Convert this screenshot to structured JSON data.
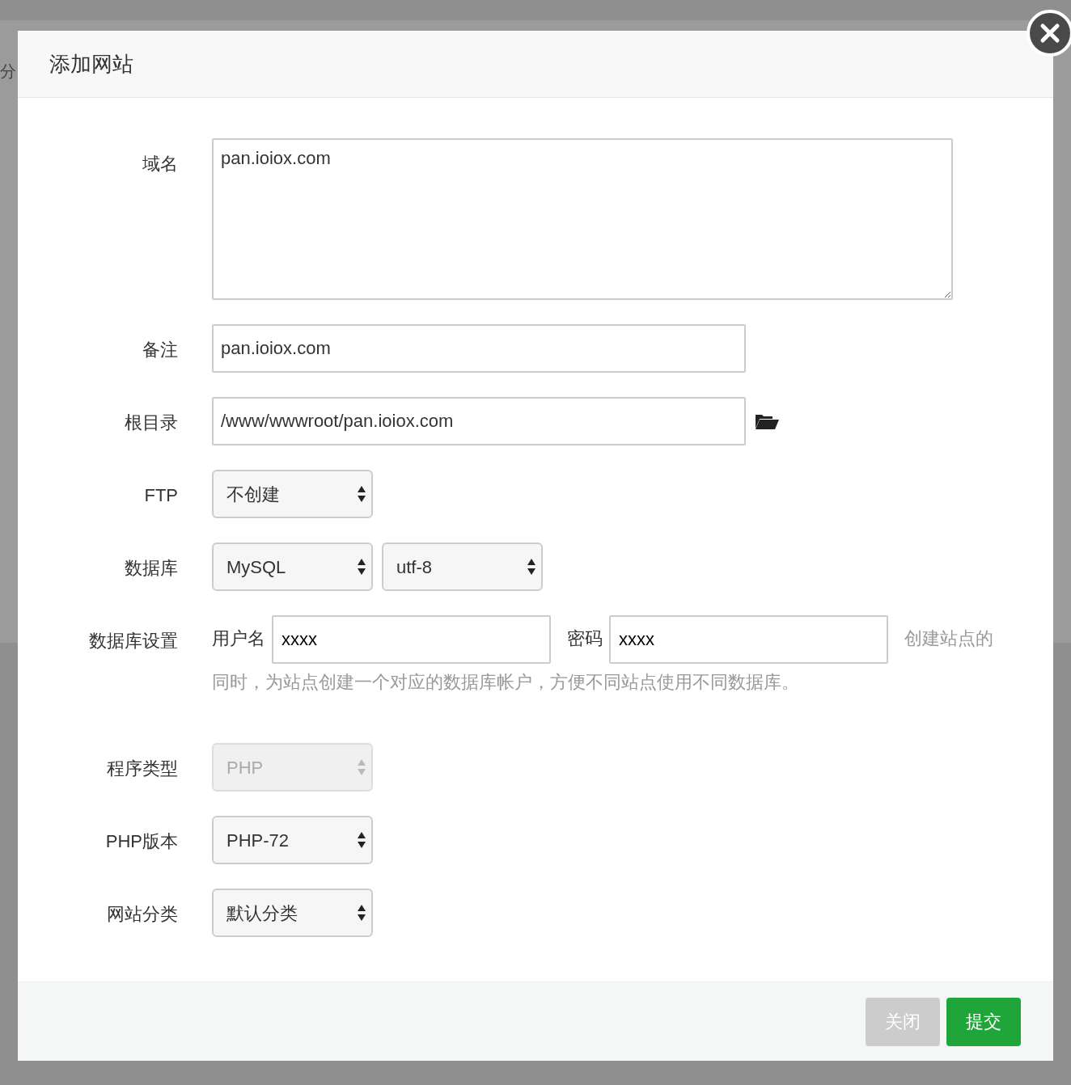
{
  "background": {
    "text": "分"
  },
  "dialog": {
    "title": "添加网站"
  },
  "rows": [
    {
      "kind": "textarea",
      "label": "域名",
      "value": "pan.ioiox.com"
    },
    {
      "kind": "input",
      "label": "备注",
      "value": "pan.ioiox.com"
    },
    {
      "kind": "path",
      "label": "根目录",
      "value": "/www/wwwroot/pan.ioiox.com"
    },
    {
      "kind": "select",
      "label": "FTP",
      "selects": [
        {
          "value": "不创建",
          "disabled": false
        }
      ]
    },
    {
      "kind": "select",
      "label": "数据库",
      "selects": [
        {
          "value": "MySQL",
          "disabled": false
        },
        {
          "value": "utf-8",
          "disabled": false
        }
      ]
    },
    {
      "kind": "credentials",
      "label": "数据库设置",
      "user_label": "用户名",
      "user_value": "xxxx",
      "password_label": "密码",
      "password_value": "xxxx",
      "hint_lines": [
        "创建站点的",
        "同时，为站点创建一个对应的数据库帐户，方便不同站点使用不同数据库。"
      ]
    },
    {
      "kind": "select",
      "label": "程序类型",
      "selects": [
        {
          "value": "PHP",
          "disabled": true
        }
      ]
    },
    {
      "kind": "select",
      "label": "PHP版本",
      "selects": [
        {
          "value": "PHP-72",
          "disabled": false
        }
      ]
    },
    {
      "kind": "select",
      "label": "网站分类",
      "selects": [
        {
          "value": "默认分类",
          "disabled": false
        }
      ]
    }
  ],
  "buttons": [
    {
      "label": "关闭",
      "kind": "secondary"
    },
    {
      "label": "提交",
      "kind": "primary"
    }
  ]
}
